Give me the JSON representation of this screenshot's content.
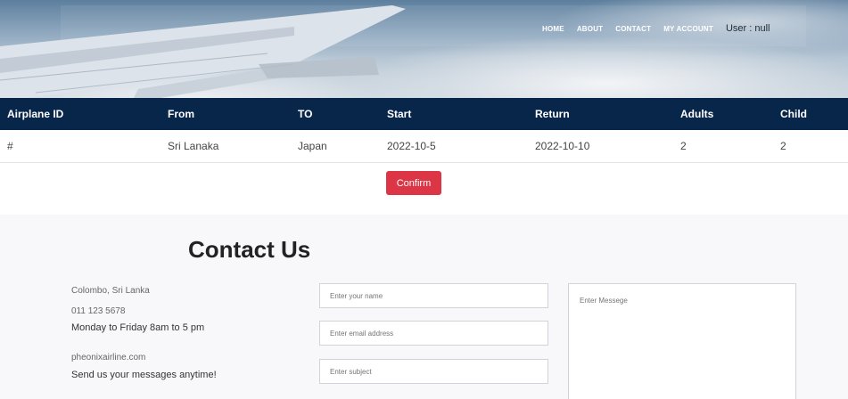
{
  "nav": {
    "links": [
      "HOME",
      "ABOUT",
      "CONTACT",
      "MY ACCOUNT"
    ],
    "user": "User : null"
  },
  "table": {
    "headers": [
      "Airplane ID",
      "From",
      "TO",
      "Start",
      "Return",
      "Adults",
      "Child"
    ],
    "rows": [
      [
        "#",
        "Sri Lanaka",
        "Japan",
        "2022-10-5",
        "2022-10-10",
        "2",
        "2"
      ]
    ]
  },
  "confirm_label": "Confirm",
  "contact": {
    "title": "Contact Us",
    "address": "Colombo, Sri Lanka",
    "phone": "011 123 5678",
    "hours": "Monday to Friday 8am to 5 pm",
    "website": "pheonixairline.com",
    "note": "Send us your messages anytime!",
    "name_placeholder": "Enter your name",
    "email_placeholder": "Enter email address",
    "subject_placeholder": "Enter subject",
    "message_placeholder": "Enter Messege"
  },
  "colors": {
    "table_header": "#08264a",
    "confirm_button": "#dc3545",
    "contact_bg": "#f8f8fa"
  }
}
